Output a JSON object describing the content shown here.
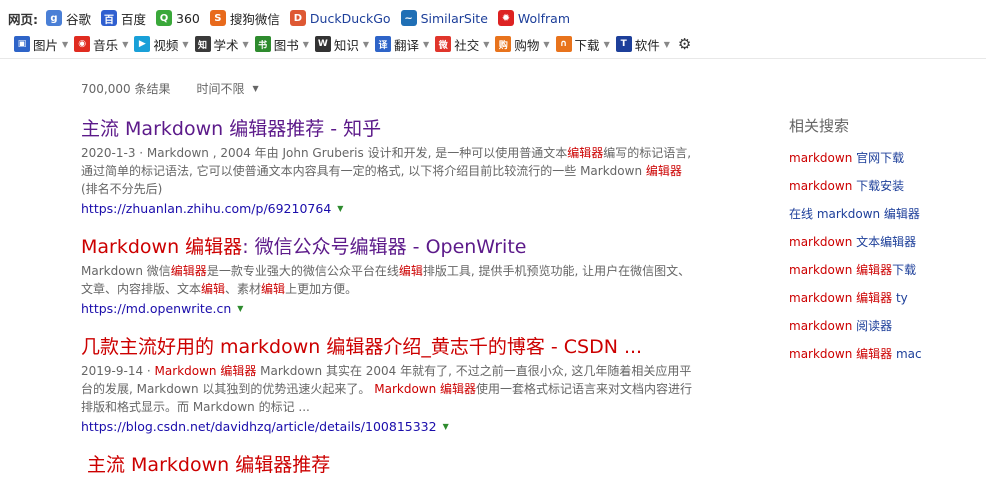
{
  "toolbar": {
    "web_label": "网页:",
    "sites": [
      {
        "icon": "google-icon",
        "label": "谷歌",
        "color": "#4a7fd6"
      },
      {
        "icon": "baidu-icon",
        "label": "百度",
        "color": "#2f5fd0"
      },
      {
        "icon": "360-icon",
        "label": "360",
        "color": "#3aa83a"
      },
      {
        "icon": "sogou-icon",
        "label": "搜狗微信",
        "color": "#e86a1c"
      },
      {
        "icon": "duckduckgo-icon",
        "label": "DuckDuckGo",
        "color": "#de5833"
      },
      {
        "icon": "similarsite-icon",
        "label": "SimilarSite",
        "color": "#1f6fb5"
      },
      {
        "icon": "wolfram-icon",
        "label": "Wolfram",
        "color": "#dd2222"
      }
    ],
    "categories": [
      {
        "icon": "image-icon",
        "label": "图片",
        "color": "#2e64c8"
      },
      {
        "icon": "music-icon",
        "label": "音乐",
        "color": "#e02b20"
      },
      {
        "icon": "video-icon",
        "label": "视频",
        "color": "#19a0d8"
      },
      {
        "icon": "scholar-icon",
        "label": "学术",
        "color": "#3a3a3a"
      },
      {
        "icon": "book-icon",
        "label": "图书",
        "color": "#2e8b2e"
      },
      {
        "icon": "wiki-icon",
        "label": "知识",
        "color": "#333333"
      },
      {
        "icon": "translate-icon",
        "label": "翻译",
        "color": "#2e64c8"
      },
      {
        "icon": "weibo-icon",
        "label": "社交",
        "color": "#e0352b"
      },
      {
        "icon": "shopping-icon",
        "label": "购物",
        "color": "#e8731c"
      },
      {
        "icon": "download-icon",
        "label": "下载",
        "color": "#e8731c"
      },
      {
        "icon": "software-icon",
        "label": "软件",
        "color": "#1d3f9a"
      }
    ]
  },
  "meta": {
    "count": "700,000 条结果",
    "time_filter": "时间不限"
  },
  "results": [
    {
      "title_pre": "主流 Markdown ",
      "title_hl": "编辑器",
      "title_post": "推荐 - 知乎",
      "snippet": [
        {
          "t": "2020-1-3 · Markdown , 2004 年由 John Gruberis 设计和开发, 是一种可以使用普通文本",
          "h": false
        },
        {
          "t": "编辑器",
          "h": true
        },
        {
          "t": "编写的标记语言, 通过简单的标记语法, 它可以使普通文本内容具有一定的格式, 以下将介绍目前比较流行的一些 Markdown ",
          "h": false
        },
        {
          "t": "编辑器",
          "h": true
        },
        {
          "t": " (排名不分先后)",
          "h": false
        }
      ],
      "url": "https://zhuanlan.zhihu.com/p/69210764"
    },
    {
      "title_pre": "Markdown ",
      "title_hl": "编辑器",
      "title_post": ": 微信公众号编辑器 - OpenWrite",
      "snippet": [
        {
          "t": "Markdown 微信",
          "h": false
        },
        {
          "t": "编辑器",
          "h": true
        },
        {
          "t": "是一款专业强大的微信公众平台在线",
          "h": false
        },
        {
          "t": "编辑",
          "h": true
        },
        {
          "t": "排版工具, 提供手机预览功能, 让用户在微信图文、文章、内容排版、文本",
          "h": false
        },
        {
          "t": "编辑",
          "h": true
        },
        {
          "t": "、素材",
          "h": false
        },
        {
          "t": "编辑",
          "h": true
        },
        {
          "t": "上更加方便。",
          "h": false
        }
      ],
      "url": "https://md.openwrite.cn"
    },
    {
      "title_pre": "几款主流好用的 markdown ",
      "title_hl": "编辑器",
      "title_post": "介绍_黄志千的博客 - CSDN ...",
      "snippet": [
        {
          "t": "2019-9-14 · ",
          "h": false
        },
        {
          "t": "Markdown 编辑器",
          "h": true
        },
        {
          "t": " Markdown 其实在 2004 年就有了, 不过之前一直很小众, 这几年随着相关应用平台的发展, Markdown 以其独到的优势迅速火起来了。 ",
          "h": false
        },
        {
          "t": "Markdown 编辑器",
          "h": true
        },
        {
          "t": "使用一套格式标记语言来对文档内容进行排版和格式显示。而 Markdown 的标记 ...",
          "h": false
        }
      ],
      "url": "https://blog.csdn.net/davidhzq/article/details/100815332"
    },
    {
      "title_pre": "主流 Markdown ",
      "title_hl": "编辑器",
      "title_post": "推荐",
      "snippet": [],
      "url": ""
    }
  ],
  "related": {
    "heading": "相关搜索",
    "items": [
      {
        "hl": "markdown ",
        "rest": "官网下载"
      },
      {
        "hl": "markdown ",
        "rest": "下载安装"
      },
      {
        "hl": "",
        "rest": "在线 markdown 编辑器"
      },
      {
        "hl": "markdown ",
        "rest": "文本编辑器"
      },
      {
        "hl": "markdown 编辑器",
        "rest": "下载"
      },
      {
        "hl": "markdown 编辑器",
        "rest": " ty"
      },
      {
        "hl": "markdown ",
        "rest": "阅读器"
      },
      {
        "hl": "markdown 编辑器",
        "rest": " mac"
      }
    ]
  }
}
